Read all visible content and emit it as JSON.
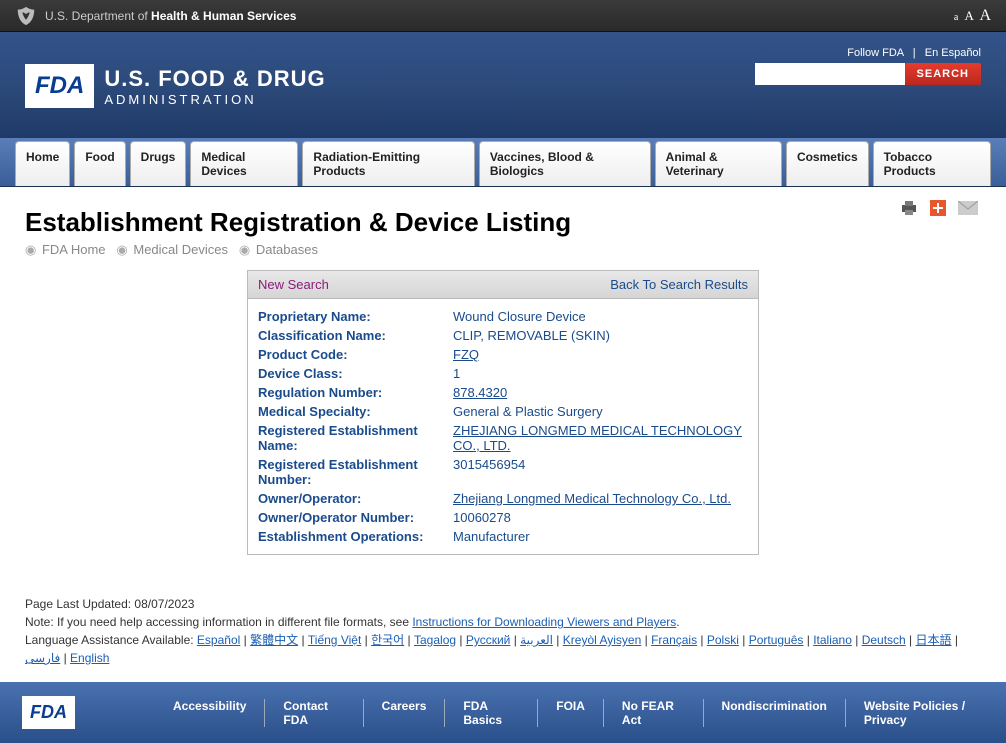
{
  "topbar": {
    "dept_prefix": "U.S. Department of ",
    "dept_bold": "Health & Human Services"
  },
  "header": {
    "badge": "FDA",
    "title1": "U.S. FOOD & DRUG",
    "title2": "ADMINISTRATION",
    "follow": "Follow FDA",
    "espanol": "En Español",
    "sep": "|",
    "searchbtn": "SEARCH"
  },
  "nav": [
    "Home",
    "Food",
    "Drugs",
    "Medical Devices",
    "Radiation-Emitting Products",
    "Vaccines, Blood & Biologics",
    "Animal & Veterinary",
    "Cosmetics",
    "Tobacco Products"
  ],
  "page": {
    "title": "Establishment Registration & Device Listing"
  },
  "breadcrumb": {
    "fda": "FDA Home",
    "med": "Medical Devices",
    "db": "Databases"
  },
  "box": {
    "new": "New Search",
    "back": "Back To Search Results",
    "fields": {
      "proprietary": {
        "l": "Proprietary Name:",
        "v": "Wound Closure Device"
      },
      "classification": {
        "l": "Classification Name:",
        "v": "CLIP, REMOVABLE (SKIN)"
      },
      "productcode": {
        "l": "Product Code:",
        "v": "FZQ"
      },
      "deviceclass": {
        "l": "Device Class:",
        "v": "1"
      },
      "regnum": {
        "l": "Regulation Number:",
        "v": "878.4320"
      },
      "specialty": {
        "l": "Medical Specialty:",
        "v": "General & Plastic Surgery"
      },
      "estname": {
        "l": "Registered Establishment Name:",
        "v": "ZHEJIANG LONGMED MEDICAL TECHNOLOGY CO., LTD."
      },
      "estnum": {
        "l": "Registered Establishment Number:",
        "v": "3015456954"
      },
      "owner": {
        "l": "Owner/Operator:",
        "v": "Zhejiang Longmed Medical Technology Co., Ltd."
      },
      "ownernum": {
        "l": "Owner/Operator Number:",
        "v": "10060278"
      },
      "ops": {
        "l": "Establishment Operations:",
        "v": "Manufacturer"
      }
    }
  },
  "footer": {
    "updated": "Page Last Updated: 08/07/2023",
    "note_prefix": "Note: If you need help accessing information in different file formats, see ",
    "note_link": "Instructions for Downloading Viewers and Players",
    "lang_prefix": "Language Assistance Available: ",
    "langs": [
      "Español",
      "繁體中文",
      "Tiếng Việt",
      "한국어",
      "Tagalog",
      "Русский",
      "العربية",
      "Kreyòl Ayisyen",
      "Français",
      "Polski",
      "Português",
      "Italiano",
      "Deutsch",
      "日本語",
      "فارسی",
      "English"
    ]
  },
  "bottomnav": [
    "Accessibility",
    "Contact FDA",
    "Careers",
    "FDA Basics",
    "FOIA",
    "No FEAR Act",
    "Nondiscrimination",
    "Website Policies / Privacy"
  ]
}
